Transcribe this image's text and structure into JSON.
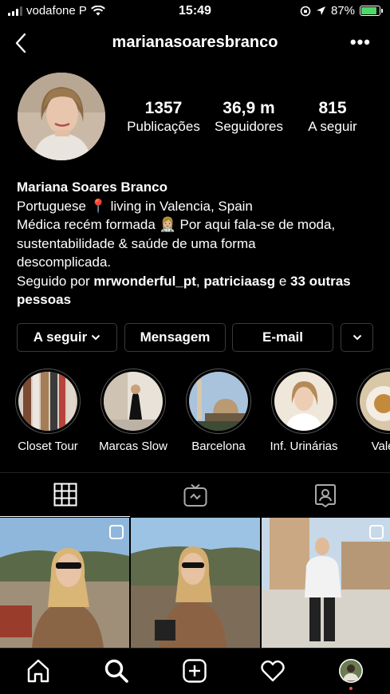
{
  "status_bar": {
    "carrier": "vodafone P",
    "time": "15:49",
    "battery": "87%",
    "battery_level": 0.87
  },
  "header": {
    "username": "marianasoaresbranco",
    "back_icon": "chevron-left-icon",
    "more_icon": "ellipsis-icon",
    "more_label": "•••"
  },
  "stats": [
    {
      "value": "1357",
      "label": "Publicações"
    },
    {
      "value": "36,9 m",
      "label": "Seguidores"
    },
    {
      "value": "815",
      "label": "A seguir"
    }
  ],
  "bio": {
    "name": "Mariana Soares Branco",
    "line1_a": "Portuguese",
    "line1_pin": "📍",
    "line1_b": "living in Valencia, Spain",
    "line2_a": "Médica recém formada",
    "line2_emoji": "👩🏼‍⚕️",
    "line2_b": "Por aqui fala-se de moda,",
    "line3": "sustentabilidade & saúde de uma forma",
    "line4": "descomplicada.",
    "followed_prefix": "Seguido por",
    "followed_user1": "mrwonderful_pt",
    "followed_sep": ",",
    "followed_user2": "patriciaasg",
    "followed_and": "e",
    "followed_others": "33 outras pessoas"
  },
  "buttons": {
    "following": "A seguir",
    "message": "Mensagem",
    "email": "E-mail"
  },
  "highlights": [
    {
      "label": "Closet Tour"
    },
    {
      "label": "Marcas Slow"
    },
    {
      "label": "Barcelona"
    },
    {
      "label": "Inf. Urinárias"
    },
    {
      "label": "Valenc"
    }
  ],
  "tabs": [
    {
      "icon": "grid-icon",
      "active": true
    },
    {
      "icon": "igtv-icon",
      "active": false
    },
    {
      "icon": "tagged-icon",
      "active": false
    }
  ],
  "nav": [
    {
      "icon": "home-icon"
    },
    {
      "icon": "search-icon"
    },
    {
      "icon": "add-post-icon"
    },
    {
      "icon": "heart-icon"
    },
    {
      "icon": "profile-avatar-icon"
    }
  ],
  "colors": {
    "background": "#000000",
    "text": "#ffffff",
    "button_border": "#3a3a3a",
    "battery": "#4cd964",
    "notification": "#ed4956"
  }
}
